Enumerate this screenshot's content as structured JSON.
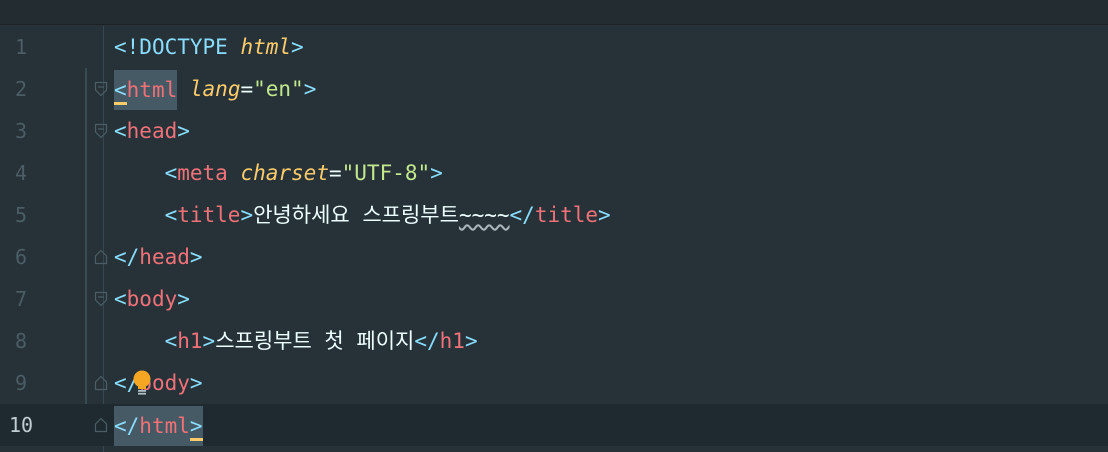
{
  "editor": {
    "language": "html",
    "current_line": 10,
    "lines": [
      {
        "number": "1",
        "tokens": [
          "<!",
          "DOCTYPE",
          " ",
          "html",
          ">"
        ]
      },
      {
        "number": "2",
        "tokens": [
          "<",
          "html",
          " ",
          "lang",
          "=",
          "\"en\"",
          ">"
        ]
      },
      {
        "number": "3",
        "tokens": [
          "<",
          "head",
          ">"
        ]
      },
      {
        "number": "4",
        "tokens": [
          "    ",
          "<",
          "meta",
          " ",
          "charset",
          "=",
          "\"UTF-8\"",
          ">"
        ]
      },
      {
        "number": "5",
        "tokens": [
          "    ",
          "<",
          "title",
          ">",
          "안녕하세요 스프링부트",
          "~~~~",
          "</",
          "title",
          ">"
        ]
      },
      {
        "number": "6",
        "tokens": [
          "</",
          "head",
          ">"
        ]
      },
      {
        "number": "7",
        "tokens": [
          "<",
          "body",
          ">"
        ]
      },
      {
        "number": "8",
        "tokens": [
          "    ",
          "<",
          "h1",
          ">",
          "스프링부트 첫 페이지",
          "</",
          "h1",
          ">"
        ]
      },
      {
        "number": "9",
        "tokens": [
          "</",
          "body",
          ">"
        ]
      },
      {
        "number": "10",
        "tokens": [
          "</",
          "html",
          ">"
        ]
      }
    ]
  },
  "colors": {
    "background": "#263238",
    "current_line": "#1e2a30",
    "punctuation": "#89ddff",
    "tag": "#f07178",
    "attribute": "#ffcb6b",
    "string": "#c3e88d",
    "text": "#eeffff",
    "line_number": "#4c5d66",
    "bulb": "#f5a623"
  },
  "icons": {
    "fold_open": "fold-open-icon",
    "fold_close": "fold-close-icon",
    "intention": "lightbulb-icon"
  }
}
